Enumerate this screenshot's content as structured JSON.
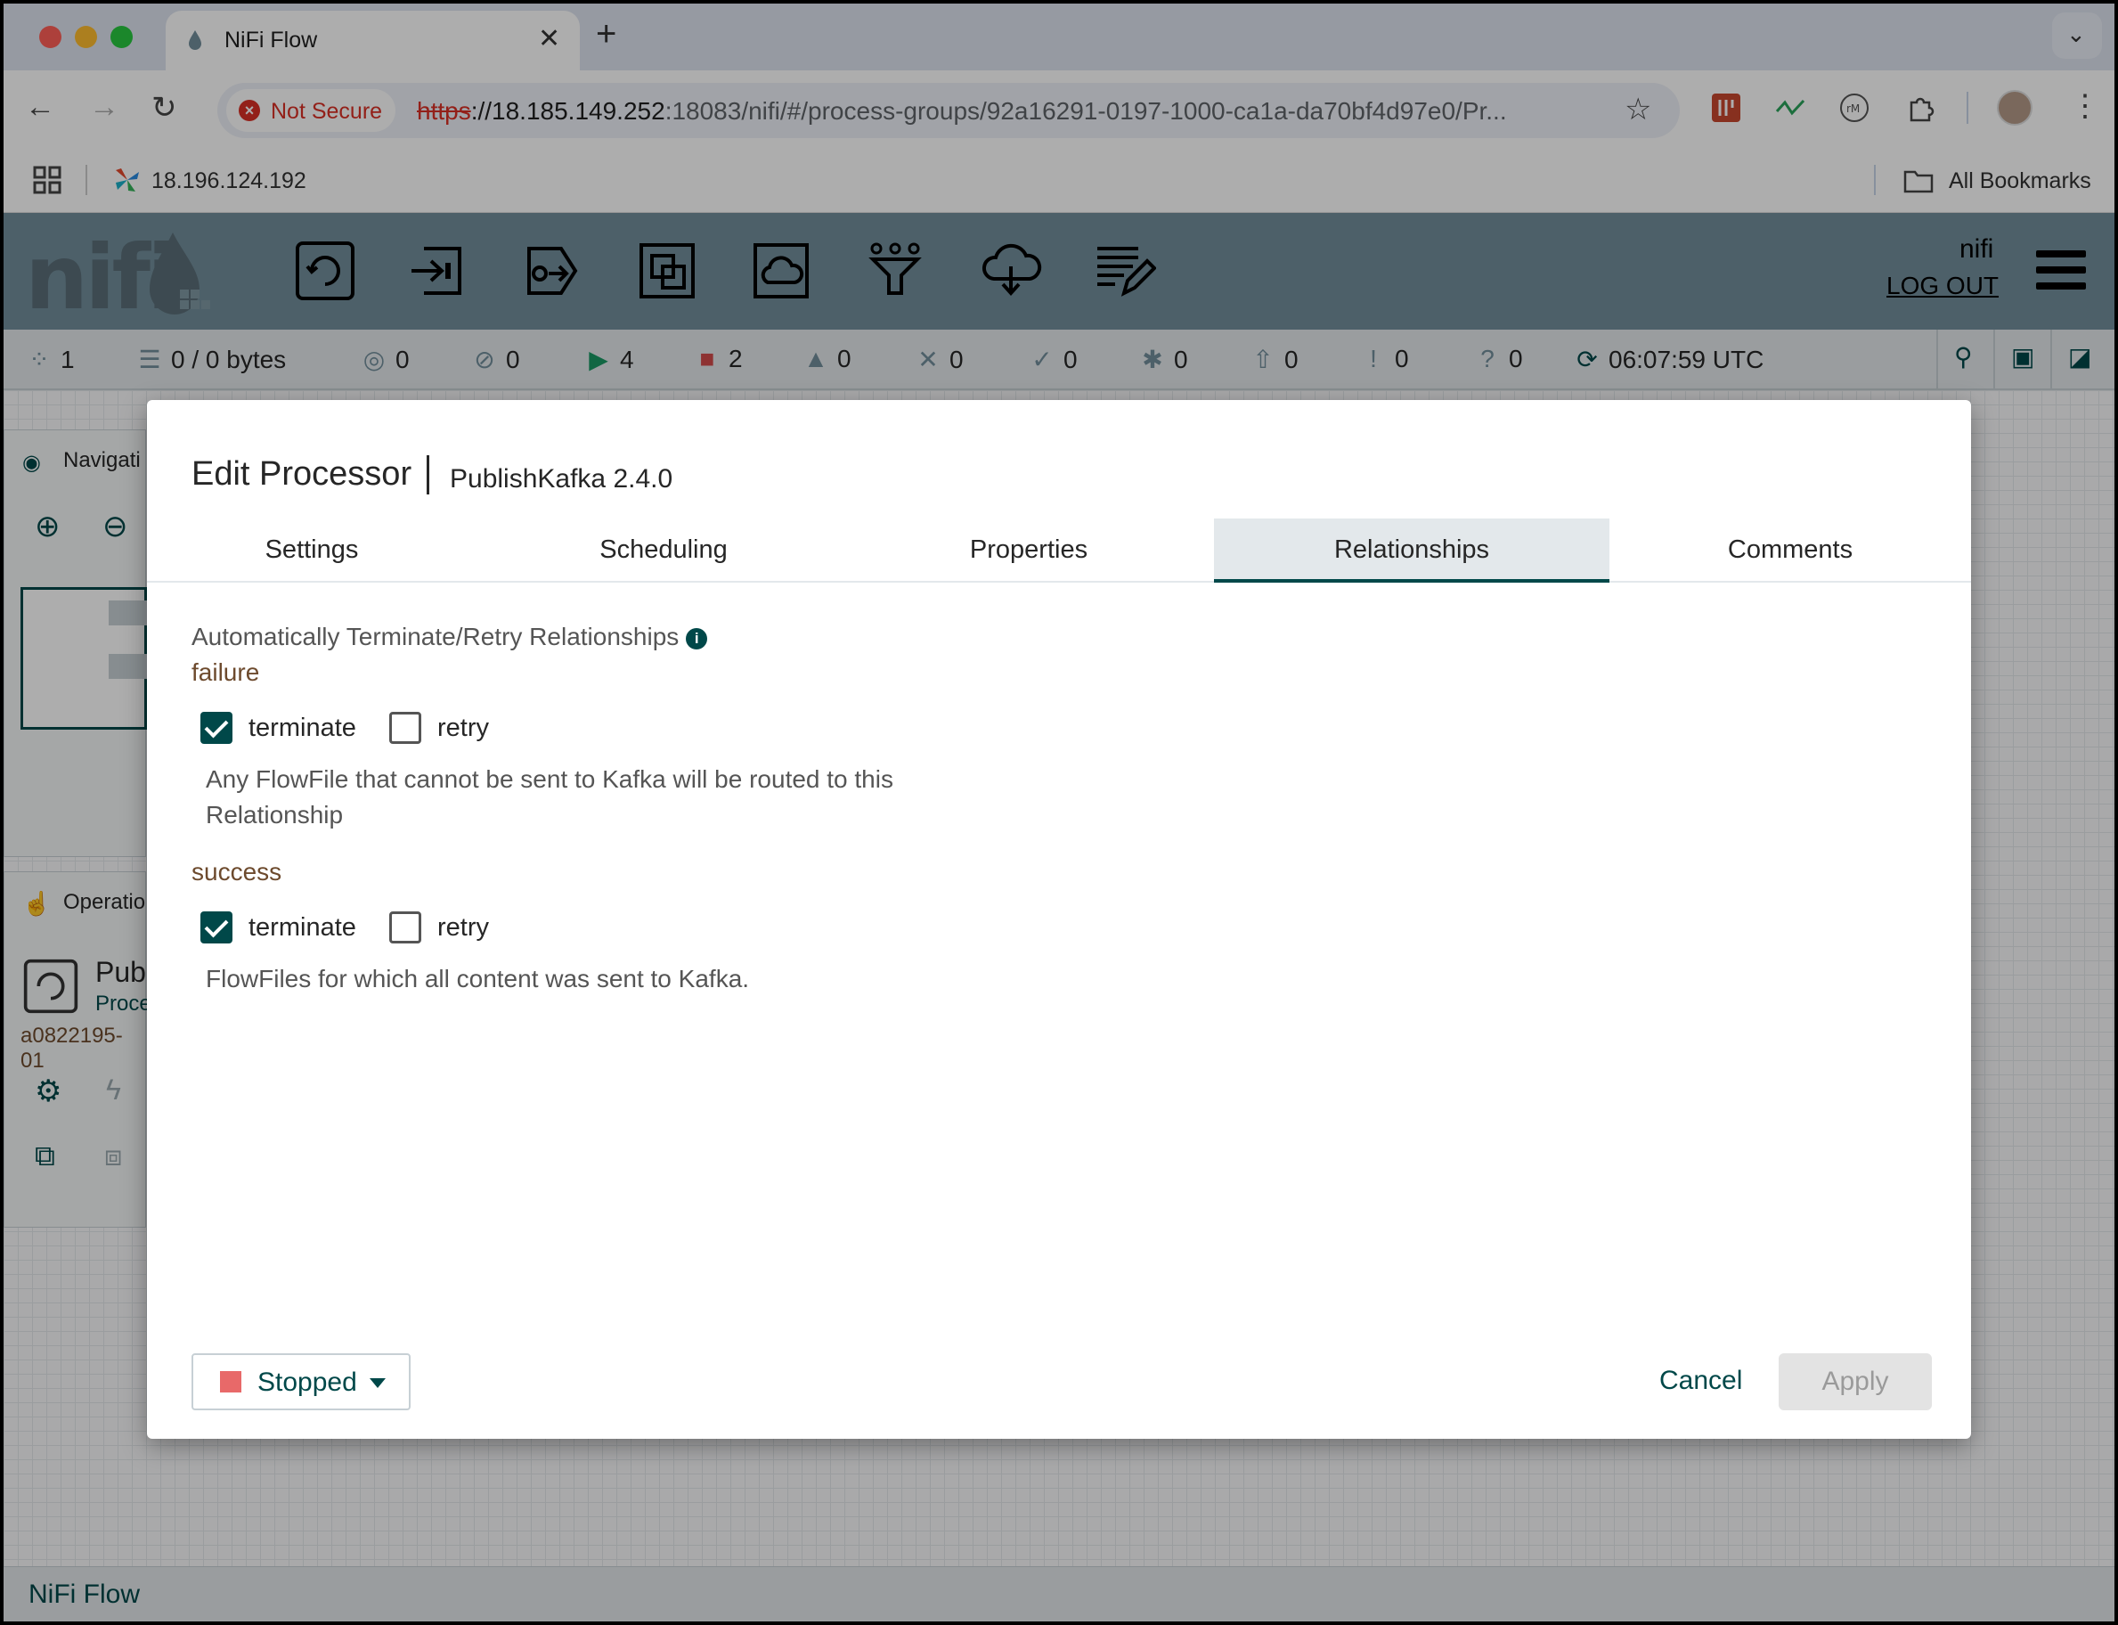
{
  "browser": {
    "tab_title": "NiFi Flow",
    "tab_close": "✕",
    "new_tab": "+",
    "tab_menu": "⌄",
    "not_secure": "Not Secure",
    "url_scheme": "https",
    "url_host": "://18.185.149.252",
    "url_rest": ":18083/nifi/#/process-groups/92a16291-0197-1000-ca1a-da70bf4d97e0/Pr...",
    "bookmark": "18.196.124.192",
    "all_bookmarks": "All Bookmarks"
  },
  "nifi": {
    "logo": "nifi",
    "user": "nifi",
    "logout": "LOG OUT",
    "components": [
      "processor-icon",
      "input-port-icon",
      "output-port-icon",
      "process-group-icon",
      "remote-process-group-icon",
      "funnel-icon",
      "template-icon",
      "label-icon"
    ]
  },
  "status": {
    "components": "1",
    "queued": "0 / 0 bytes",
    "transmitting": "0",
    "not_transmitting": "0",
    "running": "4",
    "stopped": "2",
    "invalid": "0",
    "disabled": "0",
    "up_to_date": "0",
    "locally_modified": "0",
    "stale": "0",
    "modified_stale": "0",
    "sync_failure": "0",
    "time": "06:07:59 UTC"
  },
  "canvas": {
    "navigate": "Navigati",
    "operate": "Operatio",
    "processor_name": "Publ",
    "processor_type": "Proce",
    "processor_id": "a0822195-01",
    "breadcrumb": "NiFi Flow"
  },
  "dialog": {
    "title": "Edit Processor",
    "subtitle": "PublishKafka 2.4.0",
    "tabs": [
      "Settings",
      "Scheduling",
      "Properties",
      "Relationships",
      "Comments"
    ],
    "active_tab": "Relationships",
    "heading": "Automatically Terminate/Retry Relationships",
    "relationships": [
      {
        "name": "failure",
        "terminate_label": "terminate",
        "terminate": true,
        "retry_label": "retry",
        "retry": false,
        "description_line1": "Any FlowFile that cannot be sent to Kafka will be routed to this",
        "description_line2": "Relationship"
      },
      {
        "name": "success",
        "terminate_label": "terminate",
        "terminate": true,
        "retry_label": "retry",
        "retry": false,
        "description_line1": "FlowFiles for which all content was sent to Kafka."
      }
    ],
    "run_state": "Stopped",
    "cancel": "Cancel",
    "apply": "Apply"
  },
  "colors": {
    "primary": "#004849",
    "header": "#728e9b",
    "relationship_name": "#6d4a2d",
    "stopped": "#e86969",
    "not_secure": "#d93025"
  }
}
